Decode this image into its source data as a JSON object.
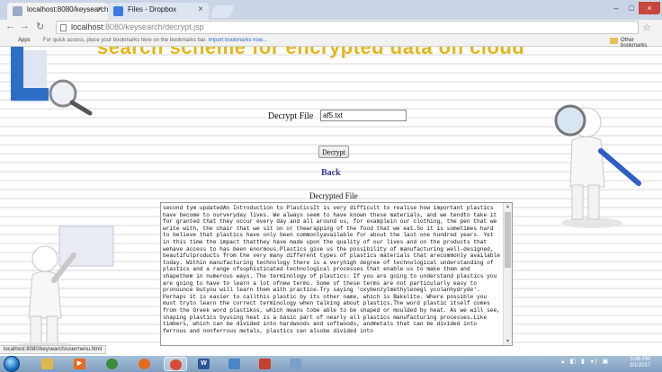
{
  "browser": {
    "tabs": [
      {
        "label": "localhost:8080/keysearch",
        "active": true
      },
      {
        "label": "Files - Dropbox",
        "active": false
      }
    ],
    "address": {
      "host": "localhost",
      "path": ":8080/keysearch/decrypt.jsp"
    },
    "bookmarks": {
      "apps_label": "Apps",
      "hint_text": "For quick access, place your bookmarks here on the bookmarks bar.",
      "hint_link": "Import bookmarks now...",
      "other_label": "Other bookmarks"
    },
    "status_url": "localhost:8080/keysearch/usermenu.html"
  },
  "page": {
    "title": "search scheme for encrypted data on cloud",
    "decrypt_file_label": "Decrypt File",
    "decrypt_file_value": "af5.txt",
    "decrypt_button": "Decrypt",
    "back_link": "Back",
    "decrypted_file_label": "Decrypted File",
    "decrypted_text": "second tym updatedAn Introduction to PlasticsIt is very difficult to realise how important plastics have become to ourveryday lives. We always seem to have known these materials, and we tendto take it for granted that they occur every day and all around us, for examplein our clothing, the pen that we write with, the chair that we sit on or thewrapping of the food that we eat.So it is sometimes hard to believe that plastics have only been commonlyavailable for about the last one hundred years. Yet in this time the impact thatthey have made upon the quality of our lives and on the products that wehave access to has been enormous.Plastics give us the possibility of manufacturing well-designed, beautifulproducts from the very many different types of plastics materials that arecommonly available today. Within manufacturing technology there is a veryhigh degree of technological understanding of plastics and a range ofsophisticated technological processes that enable us to make them and shapethem in numerous ways. The terminology of plastics: If you are going to understand plastics you are going to have to learn a lot ofnew terms. Some of these terms are not particularly easy to pronounce butyou will learn them with practice.Try saying 'oxybenzylmethylenegl ycolanhydryde'. Perhaps it is easier to callthis plastic by its other name, which is Bakelite. Where possible you must tryto learn the correct terminology when talking about plastics.The word plastic itself comes from the Greek word plastikos, which means tobe able to be shaped or moulded by heat. As we will see, shaping plastics byusing heat is a basic part of nearly all plastics manufacturing processes.Like timbers, which can be divided into hardwoods and softwoods, andmetals that can be divided into ferrous and nonferrous metals, plastics can alsobe divided into"
  },
  "taskbar": {
    "apps": [
      "explorer-icon",
      "media-player-icon",
      "chrome-icon",
      "firefox-icon",
      "chrome-icon",
      "word-icon",
      "paint-icon",
      "snipping-tool-icon",
      "paint-palette-icon"
    ],
    "clock_time": "5:08 PM",
    "clock_date": "3/1/2017"
  },
  "colors": {
    "title": "#e3b619",
    "back_link": "#3a3a8c",
    "close_button": "#c9463d"
  }
}
